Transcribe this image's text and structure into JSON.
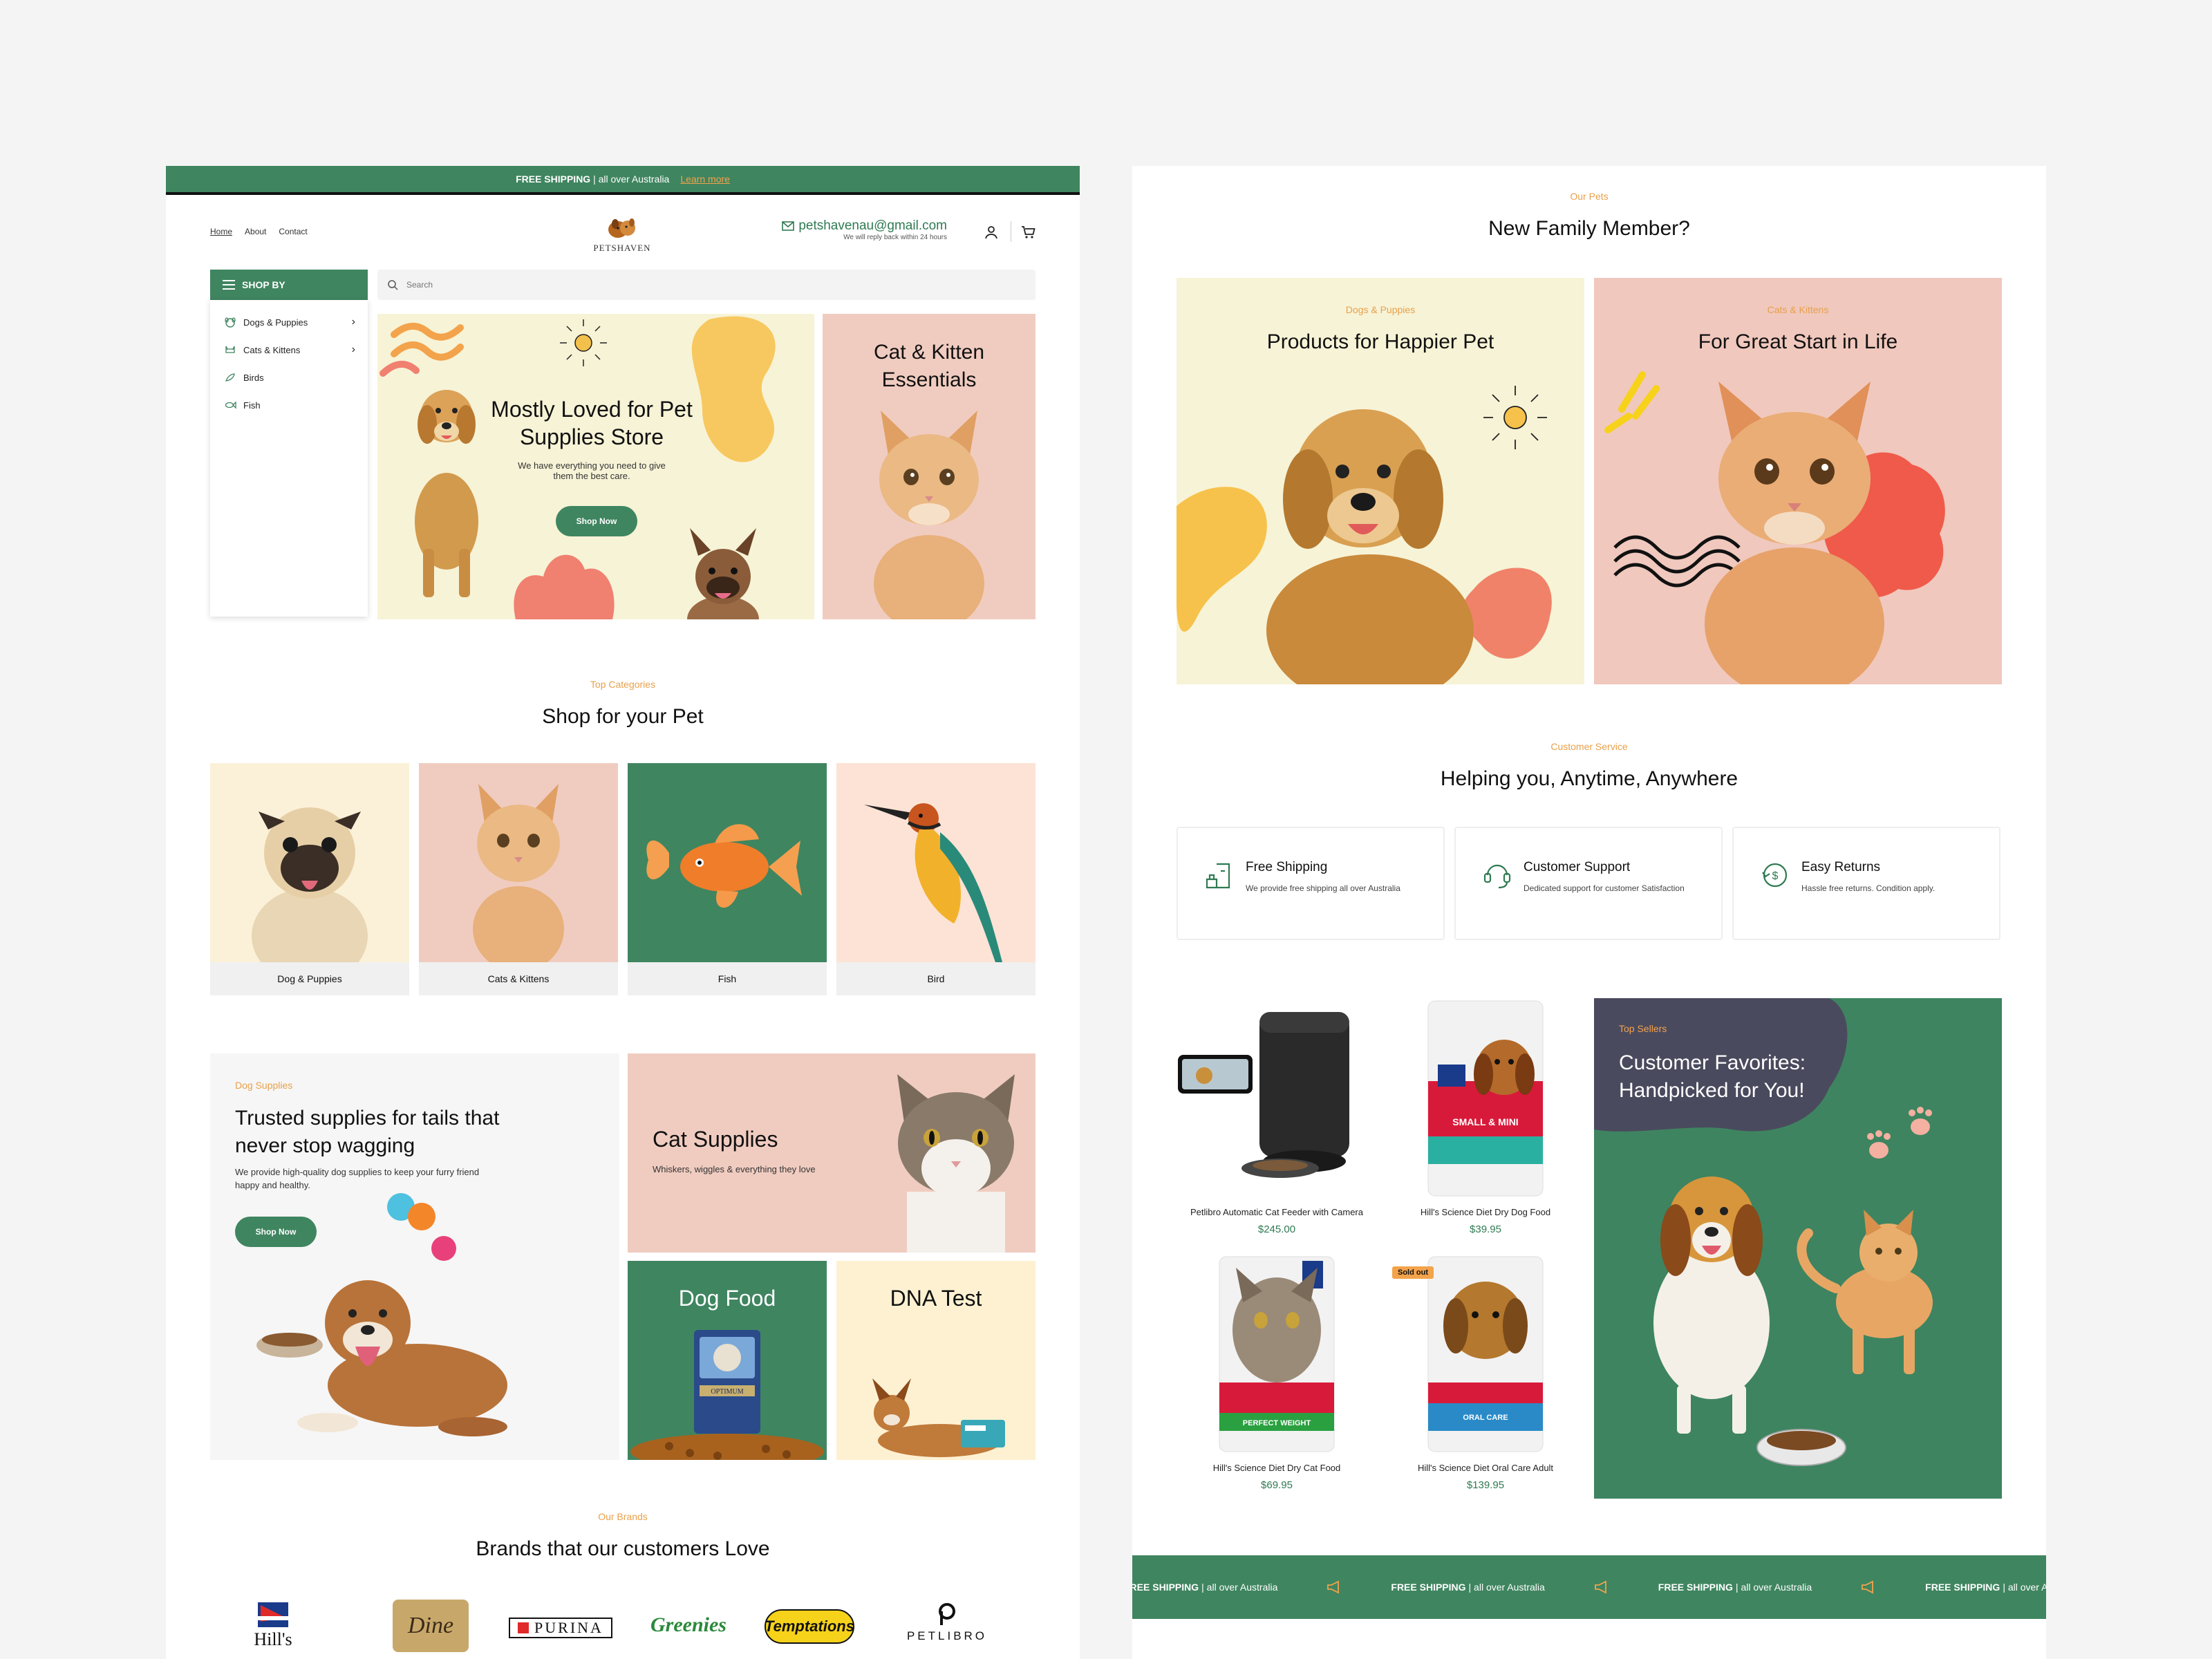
{
  "left": {
    "announcement": {
      "bold": "FREE SHIPPING",
      "text": " | all over Australia",
      "link": "Learn more"
    },
    "nav": [
      "Home",
      "About",
      "Contact"
    ],
    "logo_text": "PETSHAVEN",
    "contact": {
      "email": "petshavenau@gmail.com",
      "note": "We will reply back within 24 hours"
    },
    "shop_by": "SHOP BY",
    "menu": [
      {
        "label": "Dogs & Puppies",
        "icon": "dog-icon",
        "has_sub": true
      },
      {
        "label": "Cats & Kittens",
        "icon": "cat-icon",
        "has_sub": true
      },
      {
        "label": "Birds",
        "icon": "bird-icon",
        "has_sub": false
      },
      {
        "label": "Fish",
        "icon": "fish-icon",
        "has_sub": false
      }
    ],
    "search_placeholder": "Search",
    "hero": {
      "title": "Mostly Loved for Pet Supplies Store",
      "desc": "We have everything you need to give them the best care.",
      "button": "Shop Now"
    },
    "hero_side": {
      "title": "Cat & Kitten Essentials"
    },
    "categories": {
      "kicker": "Top Categories",
      "title": "Shop for your Pet",
      "items": [
        {
          "label": "Dog & Puppies",
          "bg": "#fbf1d8"
        },
        {
          "label": "Cats & Kittens",
          "bg": "#f0ccc0"
        },
        {
          "label": "Fish",
          "bg": "#3f8560"
        },
        {
          "label": "Bird",
          "bg": "#fde3d5"
        }
      ]
    },
    "dog_supplies": {
      "kicker": "Dog Supplies",
      "title": "Trusted supplies for tails that never stop wagging",
      "desc": "We provide high-quality dog supplies to keep your furry friend happy and healthy.",
      "button": "Shop Now"
    },
    "cat_supplies": {
      "title": "Cat Supplies",
      "desc": "Whiskers, wiggles & everything they love"
    },
    "dog_food": {
      "title": "Dog Food",
      "bag_text": "OPTIMUM"
    },
    "dna_test": {
      "title": "DNA Test"
    },
    "brands": {
      "kicker": "Our Brands",
      "title": "Brands that our customers Love",
      "logos": [
        "Hill's",
        "Dine",
        "PURINA",
        "Greenies",
        "Temptations",
        "PETLIBRO"
      ]
    }
  },
  "right": {
    "family": {
      "kicker": "Our Pets",
      "title": "New Family Member?",
      "cards": [
        {
          "kicker": "Dogs & Puppies",
          "title": "Products for Happier Pet",
          "bg": "#f7f3d6"
        },
        {
          "kicker": "Cats & Kittens",
          "title": "For Great Start in Life",
          "bg": "#f0c8bd"
        }
      ]
    },
    "service": {
      "kicker": "Customer Service",
      "title": "Helping you, Anytime, Anywhere",
      "items": [
        {
          "title": "Free Shipping",
          "desc": "We provide free shipping all over Australia",
          "icon": "shipping-icon"
        },
        {
          "title": "Customer Support",
          "desc": "Dedicated support for customer Satisfaction",
          "icon": "support-icon"
        },
        {
          "title": "Easy Returns",
          "desc": "Hassle free returns. Condition apply.",
          "icon": "returns-icon"
        }
      ]
    },
    "products": [
      {
        "name": "Petlibro Automatic Cat Feeder with Camera",
        "price": "$245.00",
        "sold_out": ""
      },
      {
        "name": "Hill's Science Diet Dry Dog Food",
        "price": "$39.95",
        "sold_out": "",
        "bag_text": "SMALL & MINI"
      },
      {
        "name": "Hill's Science Diet Dry Cat Food",
        "price": "$69.95",
        "sold_out": "",
        "bag_text": "PERFECT WEIGHT"
      },
      {
        "name": "Hill's Science Diet Oral Care Adult",
        "price": "$139.95",
        "sold_out": "Sold out",
        "bag_text": "ORAL CARE"
      }
    ],
    "favorites": {
      "kicker": "Top Sellers",
      "title": "Customer Favorites: Handpicked for You!"
    },
    "marquee": {
      "bold": "FREE SHIPPING",
      "text": " | all over Australia"
    }
  },
  "colors": {
    "brand_green": "#3f8560",
    "accent_orange": "#e8a04a",
    "cream": "#f7f3d6",
    "pink": "#f0ccc0"
  }
}
